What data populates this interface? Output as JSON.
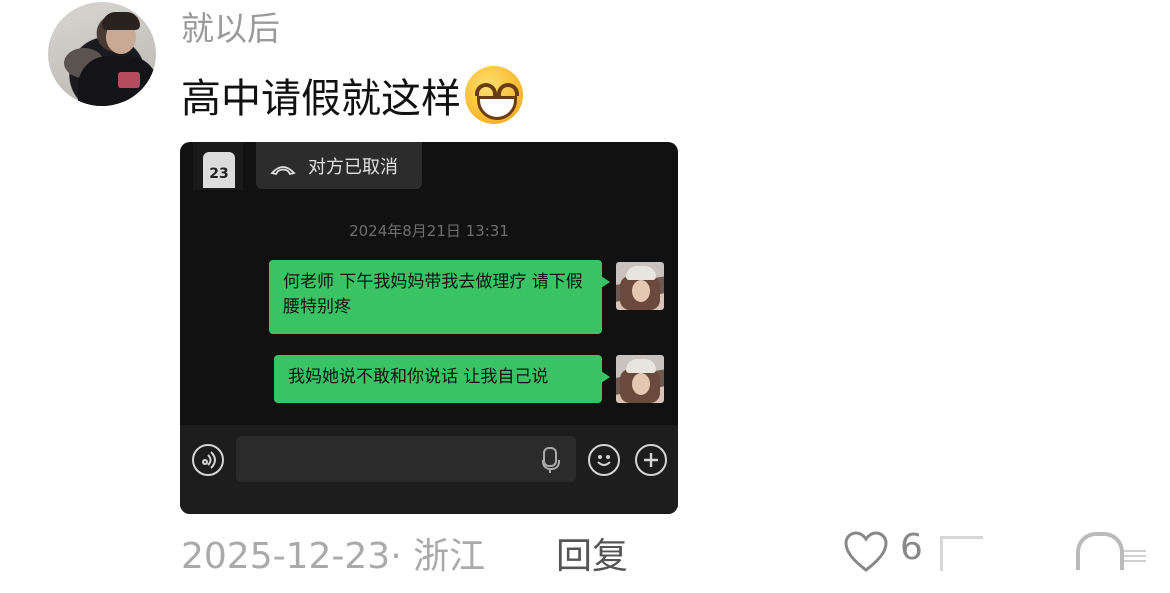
{
  "comment": {
    "username": "就以后",
    "text": "高中请假就这样",
    "emoji": "grinning-face-with-smiling-eyes"
  },
  "screenshot": {
    "call_status": "对方已取消",
    "timestamp": "2024年8月21日 13:31",
    "messages": [
      {
        "text": "何老师 下午我妈妈带我去做理疗 请下假 腰特别疼"
      },
      {
        "text": "我妈她说不敢和你说话 让我自己说"
      }
    ],
    "jersey_number": "23",
    "colors": {
      "bubble": "#39c364",
      "background": "#111111",
      "input_bar": "#1d1d1d"
    }
  },
  "footer": {
    "date_location": "2025-12-23· 浙江",
    "reply_label": "回复",
    "like_count_visible": "6"
  }
}
